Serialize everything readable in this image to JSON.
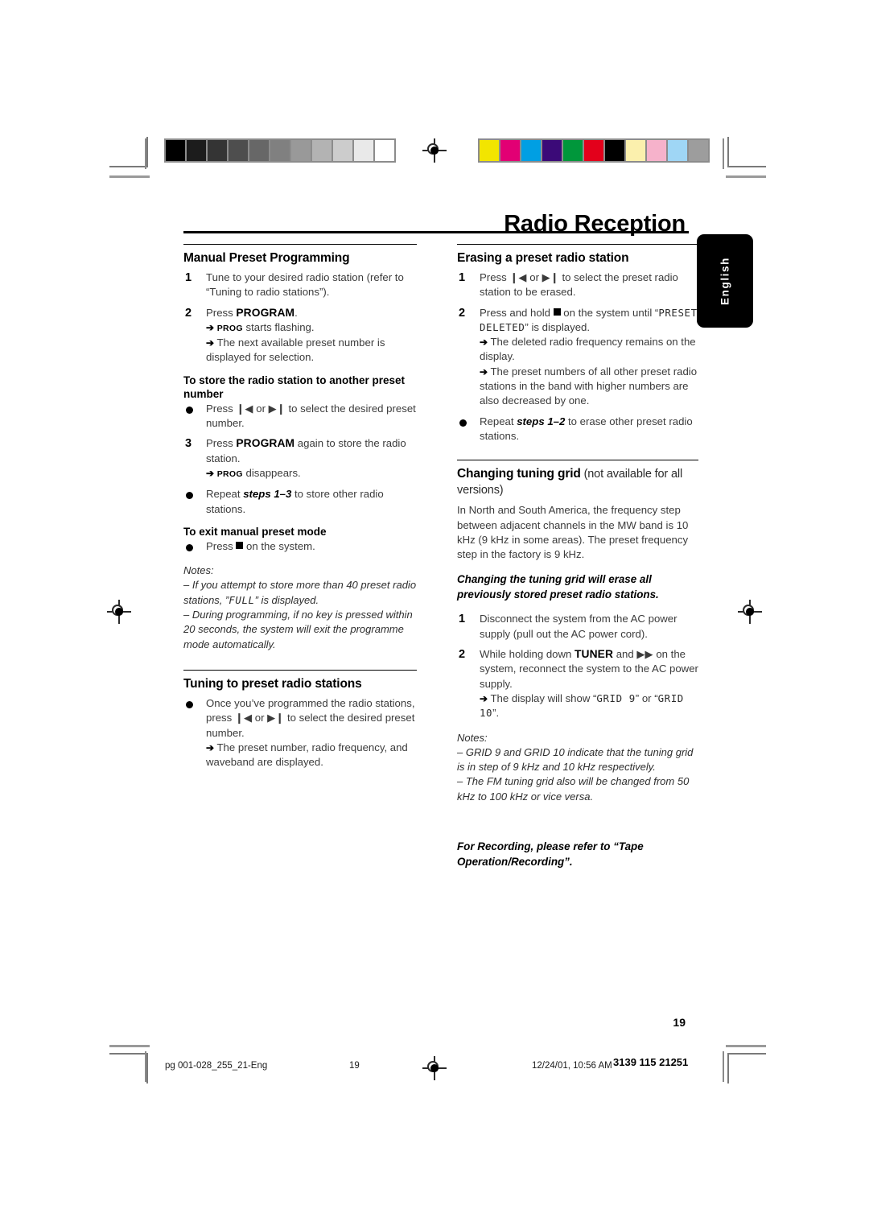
{
  "page": {
    "title": "Radio Reception",
    "folio": "19",
    "language_tab": "English"
  },
  "calibration": {
    "gray_wedge": [
      "#000000",
      "#1c1c1c",
      "#343434",
      "#4e4e4e",
      "#676767",
      "#808080",
      "#999999",
      "#b3b3b3",
      "#cccccc",
      "#e9e9e9",
      "#ffffff"
    ],
    "color_bar": [
      "#f2e500",
      "#e20074",
      "#009fe3",
      "#3b0a78",
      "#00973b",
      "#e3001b",
      "#000000",
      "#fbf0ad",
      "#f6b2cb",
      "#9fd6f5",
      "#9d9d9d"
    ]
  },
  "left_column": {
    "section1": {
      "heading": "Manual Preset Programming",
      "steps": [
        {
          "marker": "1",
          "text": "Tune to your desired radio station (refer to “Tuning to radio stations”)."
        },
        {
          "marker": "2",
          "text_pre": "Press ",
          "kbd": "PROGRAM",
          "text_post": ".",
          "arrows": [
            {
              "bold": "PROG",
              "text": " starts flashing."
            },
            {
              "bold": "",
              "text": "The next available preset number is displayed for selection."
            }
          ]
        }
      ],
      "subheading": "To store the radio station to another preset number",
      "bullet_press": "Press ❙◀ or ▶❙ to select the desired preset number.",
      "step3": {
        "marker": "3",
        "text_pre": "Press ",
        "kbd": "PROGRAM",
        "text_post": " again to store the radio station.",
        "arrow_bold": "PROG",
        "arrow_text": " disappears."
      },
      "bullet_repeat_pre": "Repeat ",
      "bullet_repeat_em": "steps 1–3",
      "bullet_repeat_post": " to store other radio stations.",
      "exit_heading": "To exit manual preset mode",
      "exit_bullet_pre": "Press ",
      "exit_bullet_post": " on the system.",
      "notes_label": "Notes:",
      "note1_pre": "–  If you attempt to store more than 40 preset radio stations, ”",
      "note1_lcd": "FULL",
      "note1_post": "” is displayed.",
      "note2": "–  During programming, if no key is pressed within 20 seconds, the system will exit the programme mode automatically."
    },
    "section2": {
      "heading": "Tuning to preset radio stations",
      "bullet": "Once you’ve programmed the radio stations, press ❙◀ or ▶❙ to select the desired preset number.",
      "arrow": "The preset number, radio frequency, and waveband are displayed."
    }
  },
  "right_column": {
    "section1": {
      "heading": "Erasing a preset radio station",
      "step1": {
        "marker": "1",
        "text": "Press ❙◀ or ▶❙ to select the preset radio station to be erased."
      },
      "step2": {
        "marker": "2",
        "text_pre": "Press and hold ",
        "text_mid": " on the system until “",
        "lcd": "PRESET DELETED",
        "text_post": "” is displayed.",
        "arrows": [
          "The deleted radio frequency remains on the display.",
          "The preset numbers of all other preset radio stations in the band with higher numbers are also decreased by one."
        ]
      },
      "bullet_repeat_pre": "Repeat ",
      "bullet_repeat_em": "steps 1–2",
      "bullet_repeat_post": " to erase other preset radio stations."
    },
    "section2": {
      "heading_bold": "Changing tuning grid",
      "heading_light": " (not available for all versions)",
      "body": "In North and South America, the frequency step between adjacent channels in the MW band is 10 kHz (9 kHz in some areas). The preset frequency step in the factory is 9 kHz.",
      "emphasis": "Changing the tuning grid will erase all previously stored preset radio stations.",
      "step1": {
        "marker": "1",
        "text": "Disconnect the system from the AC power supply (pull out the AC power cord)."
      },
      "step2": {
        "marker": "2",
        "text_pre": "While holding down ",
        "kbd": "TUNER",
        "text_mid": " and ▶▶ on the system, reconnect the system to the AC power supply.",
        "arrow_pre": "The display will show “",
        "arrow_lcd1": "GRID 9",
        "arrow_mid": "” or “",
        "arrow_lcd2": "GRID 10",
        "arrow_post": "”."
      },
      "notes_label": "Notes:",
      "note1": "–  GRID 9 and GRID 10 indicate that the tuning grid is in step of 9 kHz and 10 kHz respectively.",
      "note2": "–  The FM tuning grid also will be changed from 50 kHz to 100 kHz or vice versa.",
      "closing": "For Recording, please refer to “Tape Operation/Recording”."
    }
  },
  "footer": {
    "filename": "pg 001-028_255_21-Eng",
    "page_number": "19",
    "timestamp": "12/24/01, 10:56 AM",
    "doc_code": "3139 115 21251"
  }
}
